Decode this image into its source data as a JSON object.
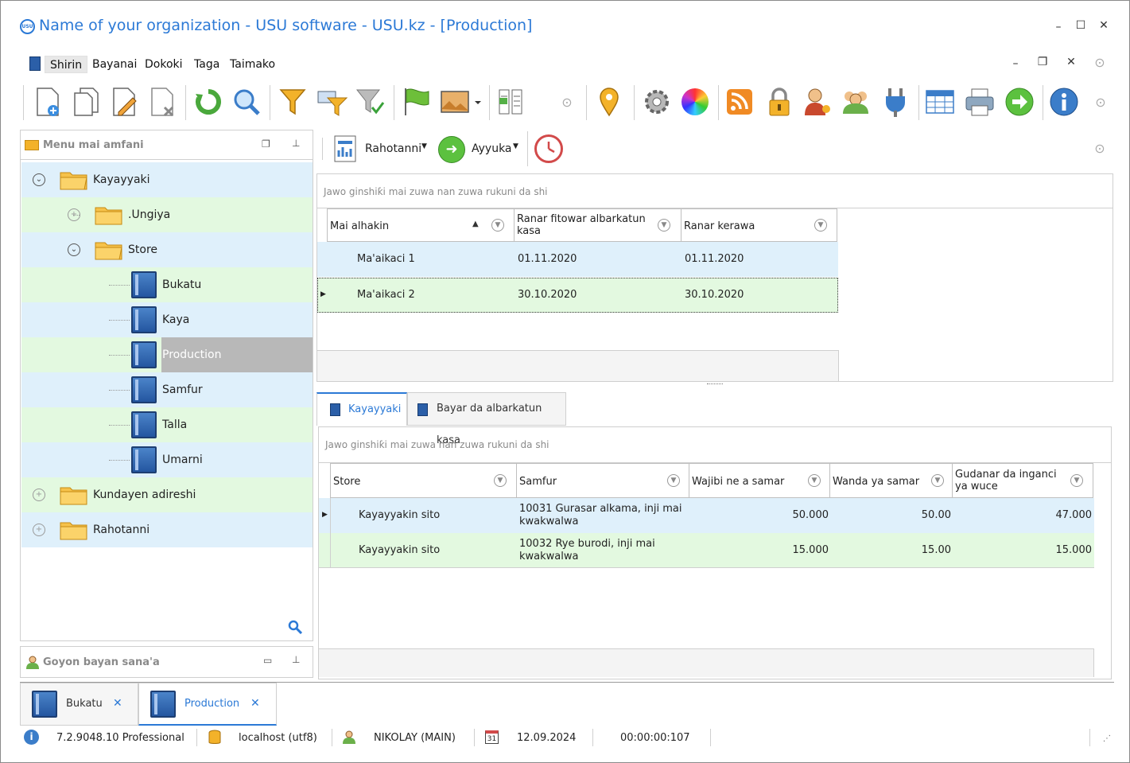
{
  "window": {
    "title": "Name of your organization - USU software - USU.kz - [Production]",
    "controls": {
      "minimize": "–",
      "maximize": "☐",
      "close": "✕"
    }
  },
  "menu": {
    "items": [
      "Shirin",
      "Bayanai",
      "Dokoki",
      "Taga",
      "Taimako"
    ],
    "active_index": 0,
    "controls": {
      "minimize": "–",
      "restore": "❐",
      "close": "✕",
      "collapse": "⊙"
    }
  },
  "toolbar": {
    "icons": [
      "add-document-icon",
      "copy-document-icon",
      "edit-document-icon",
      "delete-document-icon",
      "refresh-icon",
      "search-icon",
      "filter-icon",
      "filter-edit-icon",
      "filter-clear-icon",
      "flag-icon",
      "image-icon",
      "columns-icon",
      "location-icon",
      "gear-icon",
      "color-wheel-icon",
      "rss-icon",
      "lock-icon",
      "user-key-icon",
      "users-icon",
      "plug-icon",
      "table-icon",
      "printer-icon",
      "arrow-right-icon",
      "info-icon"
    ]
  },
  "left_panel": {
    "title": "Menu mai amfani",
    "tree": [
      {
        "label": "Kayayyaki",
        "level": 0,
        "kind": "folder",
        "expander": "⊗"
      },
      {
        "label": ".Ungiya",
        "level": 1,
        "kind": "folder",
        "expander": "⊕"
      },
      {
        "label": "Store",
        "level": 1,
        "kind": "folder-open",
        "expander": "⊗"
      },
      {
        "label": "Bukatu",
        "level": 2,
        "kind": "book"
      },
      {
        "label": "Kaya",
        "level": 2,
        "kind": "book"
      },
      {
        "label": "Production",
        "level": 2,
        "kind": "book",
        "selected": true
      },
      {
        "label": "Samfur",
        "level": 2,
        "kind": "book"
      },
      {
        "label": "Talla",
        "level": 2,
        "kind": "book"
      },
      {
        "label": "Umarni",
        "level": 2,
        "kind": "book"
      },
      {
        "label": "Kundayen adireshi",
        "level": 0,
        "kind": "folder",
        "expander": "⊕"
      },
      {
        "label": "Rahotanni",
        "level": 0,
        "kind": "folder",
        "expander": "⊕"
      }
    ]
  },
  "left_panel2": {
    "title": "Goyon bayan sana'a"
  },
  "right_toolbar": {
    "reports_label": "Rahotanni",
    "actions_label": "Ayyuka"
  },
  "grid1": {
    "filter_placeholder": "Jawo ginshiƙi mai zuwa nan zuwa rukuni da shi",
    "columns": [
      "Mai alhakin",
      "Ranar fitowar albarkatun kasa",
      "Ranar kerawa"
    ],
    "rows": [
      [
        "Ma'aikaci 1",
        "01.11.2020",
        "01.11.2020"
      ],
      [
        "Ma'aikaci 2",
        "30.10.2020",
        "30.10.2020"
      ]
    ]
  },
  "tabs": [
    "Kayayyaki",
    "Bayar da albarkatun kasa"
  ],
  "grid2": {
    "filter_placeholder": "Jawo ginshiƙi mai zuwa nan zuwa rukuni da shi",
    "columns": [
      "Store",
      "Samfur",
      "Wajibi ne a samar",
      "Wanda ya samar",
      "Gudanar da inganci ya wuce"
    ],
    "rows": [
      [
        "Kayayyakin sito",
        "10031 Gurasar alkama, inji mai kwakwalwa",
        "50.000",
        "50.00",
        "47.000"
      ],
      [
        "Kayayyakin sito",
        "10032 Rye burodi, inji mai kwakwalwa",
        "15.000",
        "15.00",
        "15.000"
      ]
    ]
  },
  "doc_tabs": [
    {
      "label": "Bukatu",
      "close": "✕"
    },
    {
      "label": "Production",
      "close": "✕"
    }
  ],
  "status": {
    "version": "7.2.9048.10 Professional",
    "db": "localhost (utf8)",
    "user": "NIKOLAY (MAIN)",
    "calendar_day": "31",
    "date": "12.09.2024",
    "timer": "00:00:00:107"
  },
  "colors": {
    "accent": "#2b79d6",
    "row_blue": "#dff0fb",
    "row_green": "#e3f9e0",
    "selected": "#b8b8b8"
  }
}
